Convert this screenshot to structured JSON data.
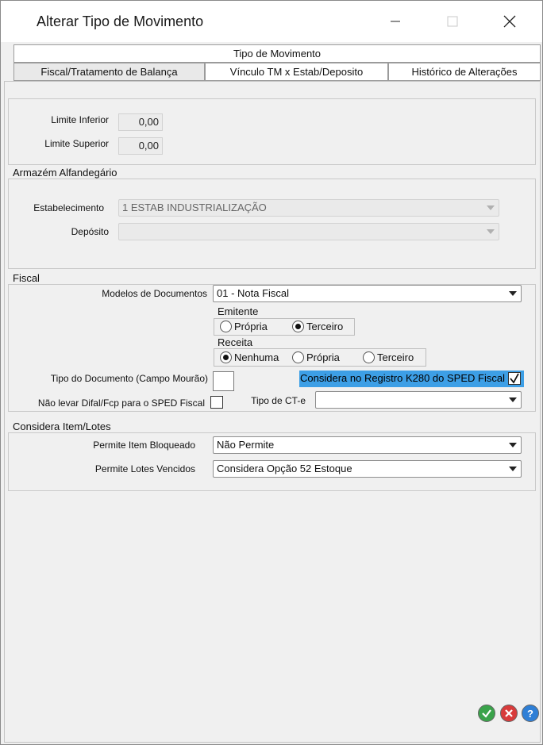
{
  "window": {
    "title": "Alterar Tipo de Movimento"
  },
  "tabs": {
    "top": "Tipo de Movimento",
    "fiscal": "Fiscal/Tratamento de Balança",
    "vinculo": "Vínculo TM x Estab/Deposito",
    "historico": "Histórico de Alterações"
  },
  "limits": {
    "inferior_label": "Limite Inferior",
    "inferior_value": "0,00",
    "superior_label": "Limite Superior",
    "superior_value": "0,00"
  },
  "armazem": {
    "title": "Armazém Alfandegário",
    "estab_label": "Estabelecimento",
    "estab_value": "1 ESTAB INDUSTRIALIZAÇÃO",
    "deposito_label": "Depósito",
    "deposito_value": ""
  },
  "fiscal": {
    "title": "Fiscal",
    "modelos_label": "Modelos de Documentos",
    "modelos_value": "01 - Nota Fiscal",
    "emitente_title": "Emitente",
    "emitente_options": [
      "Própria",
      "Terceiro"
    ],
    "emitente_selected": "Terceiro",
    "receita_title": "Receita",
    "receita_options": [
      "Nenhuma",
      "Própria",
      "Terceiro"
    ],
    "receita_selected": "Nenhuma",
    "tipo_doc_label": "Tipo do Documento (Campo Mourão)",
    "considera_label": "Considera no Registro K280 do SPED Fiscal",
    "considera_checked": true,
    "difal_label": "Não levar Difal/Fcp para o SPED Fiscal",
    "difal_checked": false,
    "ct_label": "Tipo de CT-e",
    "ct_value": ""
  },
  "lotes": {
    "title": "Considera Item/Lotes",
    "bloqueado_label": "Permite Item Bloqueado",
    "bloqueado_value": "Não Permite",
    "vencidos_label": "Permite Lotes Vencidos",
    "vencidos_value": "Considera Opção 52 Estoque"
  },
  "colors": {
    "highlight": "#3d9fe6",
    "ok": "#3aa34a",
    "cancel": "#d83b3b",
    "help": "#2f7fd6"
  }
}
